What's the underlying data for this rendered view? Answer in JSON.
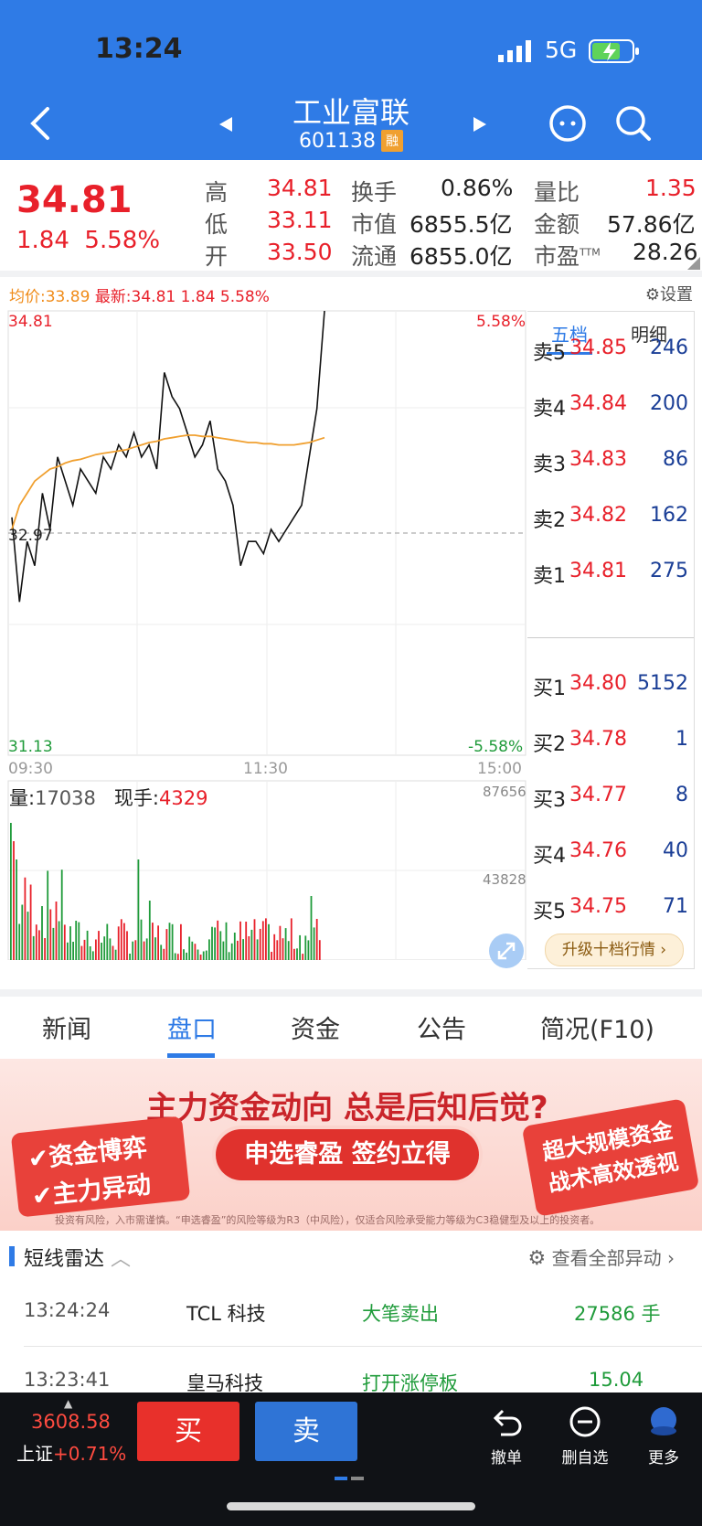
{
  "status": {
    "time": "13:24",
    "network": "5G"
  },
  "header": {
    "title": "工业富联",
    "code": "601138",
    "badge": "融"
  },
  "quote": {
    "price": "34.81",
    "change": "1.84",
    "change_pct": "5.58%",
    "stats": [
      {
        "label": "高",
        "value": "34.81"
      },
      {
        "label": "换手",
        "value": "0.86%"
      },
      {
        "label": "量比",
        "value": "1.35"
      },
      {
        "label": "低",
        "value": "33.11"
      },
      {
        "label": "市值",
        "value": "6855.5亿"
      },
      {
        "label": "金额",
        "value": "57.86亿"
      },
      {
        "label": "开",
        "value": "33.50"
      },
      {
        "label": "流通",
        "value": "6855.0亿"
      },
      {
        "label": "市盈",
        "value": "28.26"
      }
    ],
    "pe_sup": "TTM"
  },
  "chart_info": {
    "avg_label": "均价:",
    "avg": "33.89",
    "latest_label": "最新:",
    "latest": "34.81",
    "chg": "1.84",
    "pct": "5.58%",
    "settings": "设置"
  },
  "chart_data": {
    "type": "line",
    "title": "",
    "y_max_label": "34.81",
    "y_mid_label": "32.97",
    "y_min_label": "31.13",
    "pct_top": "5.58%",
    "pct_bottom": "-5.58%",
    "x_ticks": [
      "09:30",
      "11:30",
      "15:00"
    ],
    "ylim": [
      31.13,
      34.81
    ],
    "series": [
      {
        "values": [
          33.1,
          32.4,
          32.9,
          32.7,
          33.3,
          33.0,
          33.6,
          33.4,
          33.2,
          33.5,
          33.4,
          33.3,
          33.6,
          33.5,
          33.7,
          33.6,
          33.8,
          33.6,
          33.7,
          33.5,
          34.3,
          34.1,
          34.0,
          33.8,
          33.6,
          33.7,
          33.9,
          33.5,
          33.4,
          33.2,
          32.7,
          32.9,
          32.9,
          32.8,
          33.0,
          32.9,
          33.0,
          33.1,
          33.2,
          33.6,
          34.0,
          34.81
        ]
      },
      {
        "values": [
          33.0,
          33.2,
          33.3,
          33.4,
          33.45,
          33.5,
          33.52,
          33.55,
          33.57,
          33.58,
          33.6,
          33.62,
          33.63,
          33.64,
          33.65,
          33.66,
          33.68,
          33.7,
          33.72,
          33.73,
          33.75,
          33.76,
          33.77,
          33.78,
          33.78,
          33.77,
          33.77,
          33.76,
          33.75,
          33.74,
          33.73,
          33.72,
          33.72,
          33.71,
          33.71,
          33.7,
          33.7,
          33.7,
          33.71,
          33.72,
          33.74,
          33.76
        ]
      }
    ]
  },
  "volume": {
    "label": "量:",
    "value": "17038",
    "hand_label": "现手:",
    "hand": "4329",
    "max": "87656",
    "mid": "43828"
  },
  "orderbook": {
    "tabs": [
      "五档",
      "明细"
    ],
    "asks": [
      {
        "k": "卖5",
        "p": "34.85",
        "v": "246"
      },
      {
        "k": "卖4",
        "p": "34.84",
        "v": "200"
      },
      {
        "k": "卖3",
        "p": "34.83",
        "v": "86"
      },
      {
        "k": "卖2",
        "p": "34.82",
        "v": "162"
      },
      {
        "k": "卖1",
        "p": "34.81",
        "v": "275"
      }
    ],
    "bids": [
      {
        "k": "买1",
        "p": "34.80",
        "v": "5152"
      },
      {
        "k": "买2",
        "p": "34.78",
        "v": "1"
      },
      {
        "k": "买3",
        "p": "34.77",
        "v": "8"
      },
      {
        "k": "买4",
        "p": "34.76",
        "v": "40"
      },
      {
        "k": "买5",
        "p": "34.75",
        "v": "71"
      }
    ],
    "upgrade": "升级十档行情 ›"
  },
  "tabs": [
    "新闻",
    "盘口",
    "资金",
    "公告",
    "简况(F10)"
  ],
  "banner": {
    "headline": "主力资金动向 总是后知后觉?",
    "left1": "资金博弈",
    "left2": "主力异动",
    "cta": "申选睿盈 签约立得",
    "right1": "超大规模资金",
    "right2": "战术高效透视",
    "disclaimer": "投资有风险，入市需谨慎。“申选睿盈”的风险等级为R3（中风险），仅适合风险承受能力等级为C3稳健型及以上的投资者。"
  },
  "radar": {
    "title": "短线雷达",
    "view_all": "查看全部异动",
    "rows": [
      {
        "time": "13:24:24",
        "name": "TCL 科技",
        "event": "大笔卖出",
        "value": "27586 手"
      },
      {
        "time": "13:23:41",
        "name": "皇马科技",
        "event": "打开涨停板",
        "value": "15.04"
      }
    ]
  },
  "bottom": {
    "index_value": "3608.58",
    "index_name": "上证",
    "index_pct": "+0.71%",
    "buy": "买",
    "sell": "卖",
    "cancel": "撤单",
    "remove": "删自选",
    "more": "更多"
  }
}
